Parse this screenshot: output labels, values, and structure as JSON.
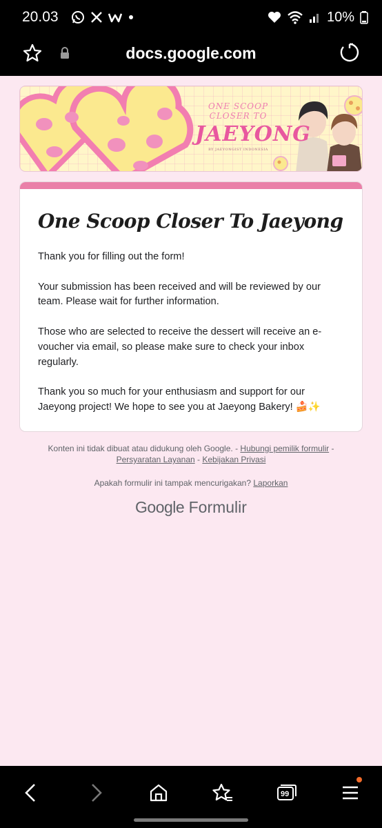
{
  "status_bar": {
    "time": "20.03",
    "app_icons": [
      "whatsapp-icon",
      "x-icon",
      "webtoon-icon",
      "dot-icon"
    ],
    "battery": "10%",
    "status_icons": [
      "heart-icon",
      "wifi-icon",
      "signal-icon",
      "battery-icon"
    ]
  },
  "browser": {
    "url": "docs.google.com"
  },
  "banner": {
    "title_line1": "ONE SCOOP CLOSER TO",
    "title_line2": "JAEYONG",
    "credit": "BY JAEYONGIST INDONESIA"
  },
  "form": {
    "title": "One Scoop Closer To Jaeyong",
    "paragraphs": [
      "Thank you for filling out the form!",
      "Your submission has been received and will be reviewed by our team. Please wait for further information.",
      "Those who are selected to receive the dessert will receive an e-voucher via email, so please make sure to check your inbox regularly.",
      "Thank you so much for your enthusiasm and support for our Jaeyong project! We hope to see you at Jaeyong Bakery! 🍰✨"
    ]
  },
  "footer": {
    "disclaimer": "Konten ini tidak dibuat atau didukung oleh Google. -",
    "contact_owner": "Hubungi pemilik formulir",
    "sep1": "-",
    "terms": "Persyaratan Layanan",
    "sep2": "-",
    "privacy": "Kebijakan Privasi",
    "suspicious": "Apakah formulir ini tampak mencurigakan?",
    "report": "Laporkan",
    "logo_google": "Google",
    "logo_forms": "Formulir"
  },
  "bottom_nav": {
    "tabs_count": "99"
  },
  "colors": {
    "page_bg": "#fce8f1",
    "accent": "#ea7fa8",
    "system_bar": "#000000",
    "notification_dot": "#f26b2a"
  }
}
